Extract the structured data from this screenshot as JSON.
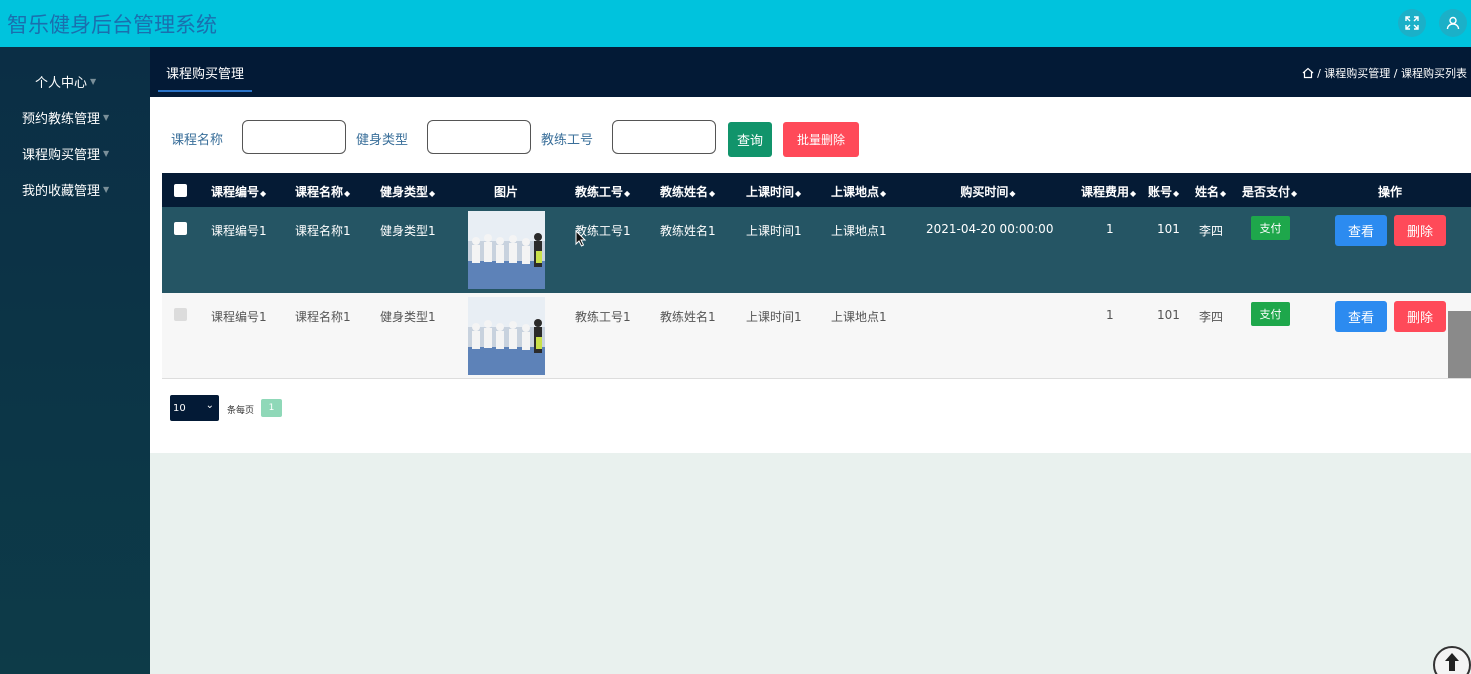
{
  "app": {
    "title": "智乐健身后台管理系统"
  },
  "sidebar": {
    "items": [
      {
        "label": "个人中心"
      },
      {
        "label": "预约教练管理"
      },
      {
        "label": "课程购买管理"
      },
      {
        "label": "我的收藏管理"
      }
    ]
  },
  "subheader": {
    "tab": "课程购买管理",
    "breadcrumb": "/ 课程购买管理 / 课程购买列表"
  },
  "filters": {
    "course_name_label": "课程名称",
    "type_label": "健身类型",
    "coach_id_label": "教练工号",
    "query_button": "查询",
    "batch_delete_button": "批量删除"
  },
  "table": {
    "headers": [
      "课程编号",
      "课程名称",
      "健身类型",
      "图片",
      "教练工号",
      "教练姓名",
      "上课时间",
      "上课地点",
      "购买时间",
      "课程费用",
      "账号",
      "姓名",
      "是否支付",
      "操作"
    ],
    "rows": [
      {
        "course_no": "课程编号1",
        "course_name": "课程名称1",
        "type": "健身类型1",
        "coach_id": "教练工号1",
        "coach_name": "教练姓名1",
        "class_time": "上课时间1",
        "location": "上课地点1",
        "purchase_time": "2021-04-20 00:00:00",
        "fee": "1",
        "account": "101",
        "name": "李四",
        "paid": "支付",
        "view": "查看",
        "delete": "删除"
      },
      {
        "course_no": "课程编号1",
        "course_name": "课程名称1",
        "type": "健身类型1",
        "coach_id": "教练工号1",
        "coach_name": "教练姓名1",
        "class_time": "上课时间1",
        "location": "上课地点1",
        "purchase_time": "",
        "fee": "1",
        "account": "101",
        "name": "李四",
        "paid": "支付",
        "view": "查看",
        "delete": "删除"
      }
    ]
  },
  "pagination": {
    "page_size": "10",
    "per_page_label": "条每页",
    "current_page": "1"
  },
  "colors": {
    "topbar": "#00c3dd",
    "header_dark": "#031a36",
    "row_highlight": "#255564",
    "primary_green": "#11946b",
    "danger": "#ff4a59",
    "view_blue": "#2c8bf0",
    "paid_green": "#1ea74b"
  },
  "icons": {
    "fullscreen": "expand-icon",
    "user": "user-icon",
    "home": "home-icon",
    "back_to_top": "arrow-up-icon"
  }
}
